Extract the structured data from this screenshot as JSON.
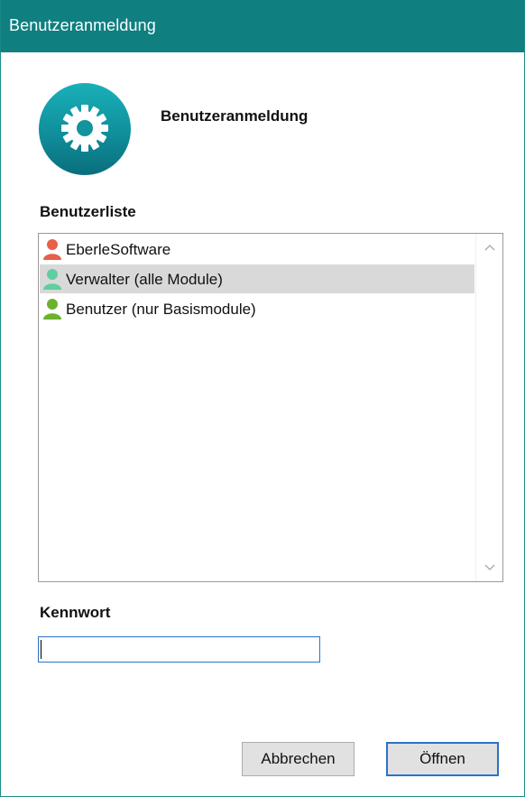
{
  "window": {
    "title": "Benutzeranmeldung"
  },
  "header": {
    "title": "Benutzeranmeldung",
    "logo_icon": "gear-icon"
  },
  "userlist": {
    "label": "Benutzerliste",
    "items": [
      {
        "label": "EberleSoftware",
        "icon": "user-icon",
        "icon_color": "#e8604a",
        "selected": false
      },
      {
        "label": "Verwalter (alle Module)",
        "icon": "user-icon",
        "icon_color": "#5fcf9f",
        "selected": true
      },
      {
        "label": "Benutzer (nur Basismodule)",
        "icon": "user-icon",
        "icon_color": "#6cb22e",
        "selected": false
      }
    ]
  },
  "password": {
    "label": "Kennwort",
    "value": ""
  },
  "buttons": {
    "cancel": "Abbrechen",
    "open": "Öffnen"
  },
  "colors": {
    "titlebar": "#0f7f80",
    "accent": "#2a73c8",
    "selection": "#d9d9d9"
  }
}
